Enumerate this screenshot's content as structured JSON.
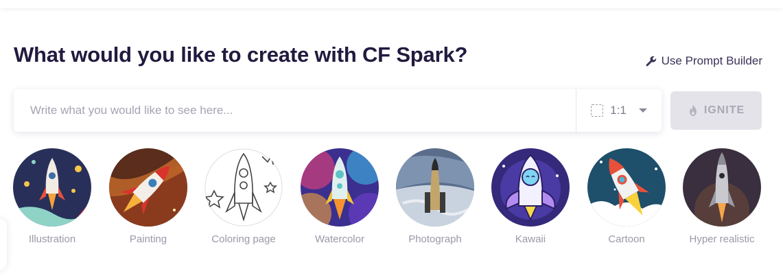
{
  "header": {
    "title": "What would you like to create with CF Spark?",
    "prompt_builder_label": "Use Prompt Builder",
    "prompt_builder_icon": "wrench-icon"
  },
  "prompt": {
    "placeholder": "Write what you would like to see here...",
    "value": "",
    "aspect_ratio": "1:1",
    "ignite_label": "IGNITE",
    "ignite_icon": "flame-icon"
  },
  "styles": [
    {
      "label": "Illustration"
    },
    {
      "label": "Painting"
    },
    {
      "label": "Coloring page"
    },
    {
      "label": "Watercolor"
    },
    {
      "label": "Photograph"
    },
    {
      "label": "Kawaii"
    },
    {
      "label": "Cartoon"
    },
    {
      "label": "Hyper realistic"
    }
  ],
  "colors": {
    "heading": "#221a3f",
    "link": "#3b3258",
    "button_disabled_bg": "#e4e3ea",
    "button_disabled_text": "#a9a8b5",
    "label": "#9b98a8"
  }
}
